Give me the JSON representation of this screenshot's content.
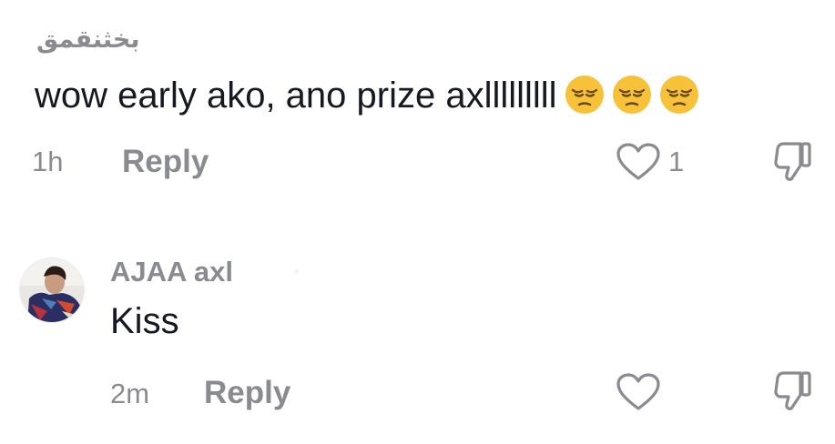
{
  "comments": [
    {
      "username": "بخثنقمق",
      "text": "wow early ako, ano prize axlllllllll",
      "emojis": [
        "pensive-face",
        "pensive-face",
        "pensive-face"
      ],
      "time": "1h",
      "reply_label": "Reply",
      "like_count": "1",
      "icons": {
        "like": "heart-outline-icon",
        "dislike": "thumbs-down-outline-icon"
      }
    },
    {
      "username": "AJAA axl",
      "text": "Kiss",
      "time": "2m",
      "reply_label": "Reply",
      "icons": {
        "like": "heart-outline-icon",
        "dislike": "thumbs-down-outline-icon",
        "avatar": "user-avatar-photo"
      }
    }
  ],
  "colors": {
    "primary_text": "#161823",
    "secondary_text": "#8a8b91",
    "emoji_face": "#f7c23a",
    "background": "#ffffff"
  }
}
